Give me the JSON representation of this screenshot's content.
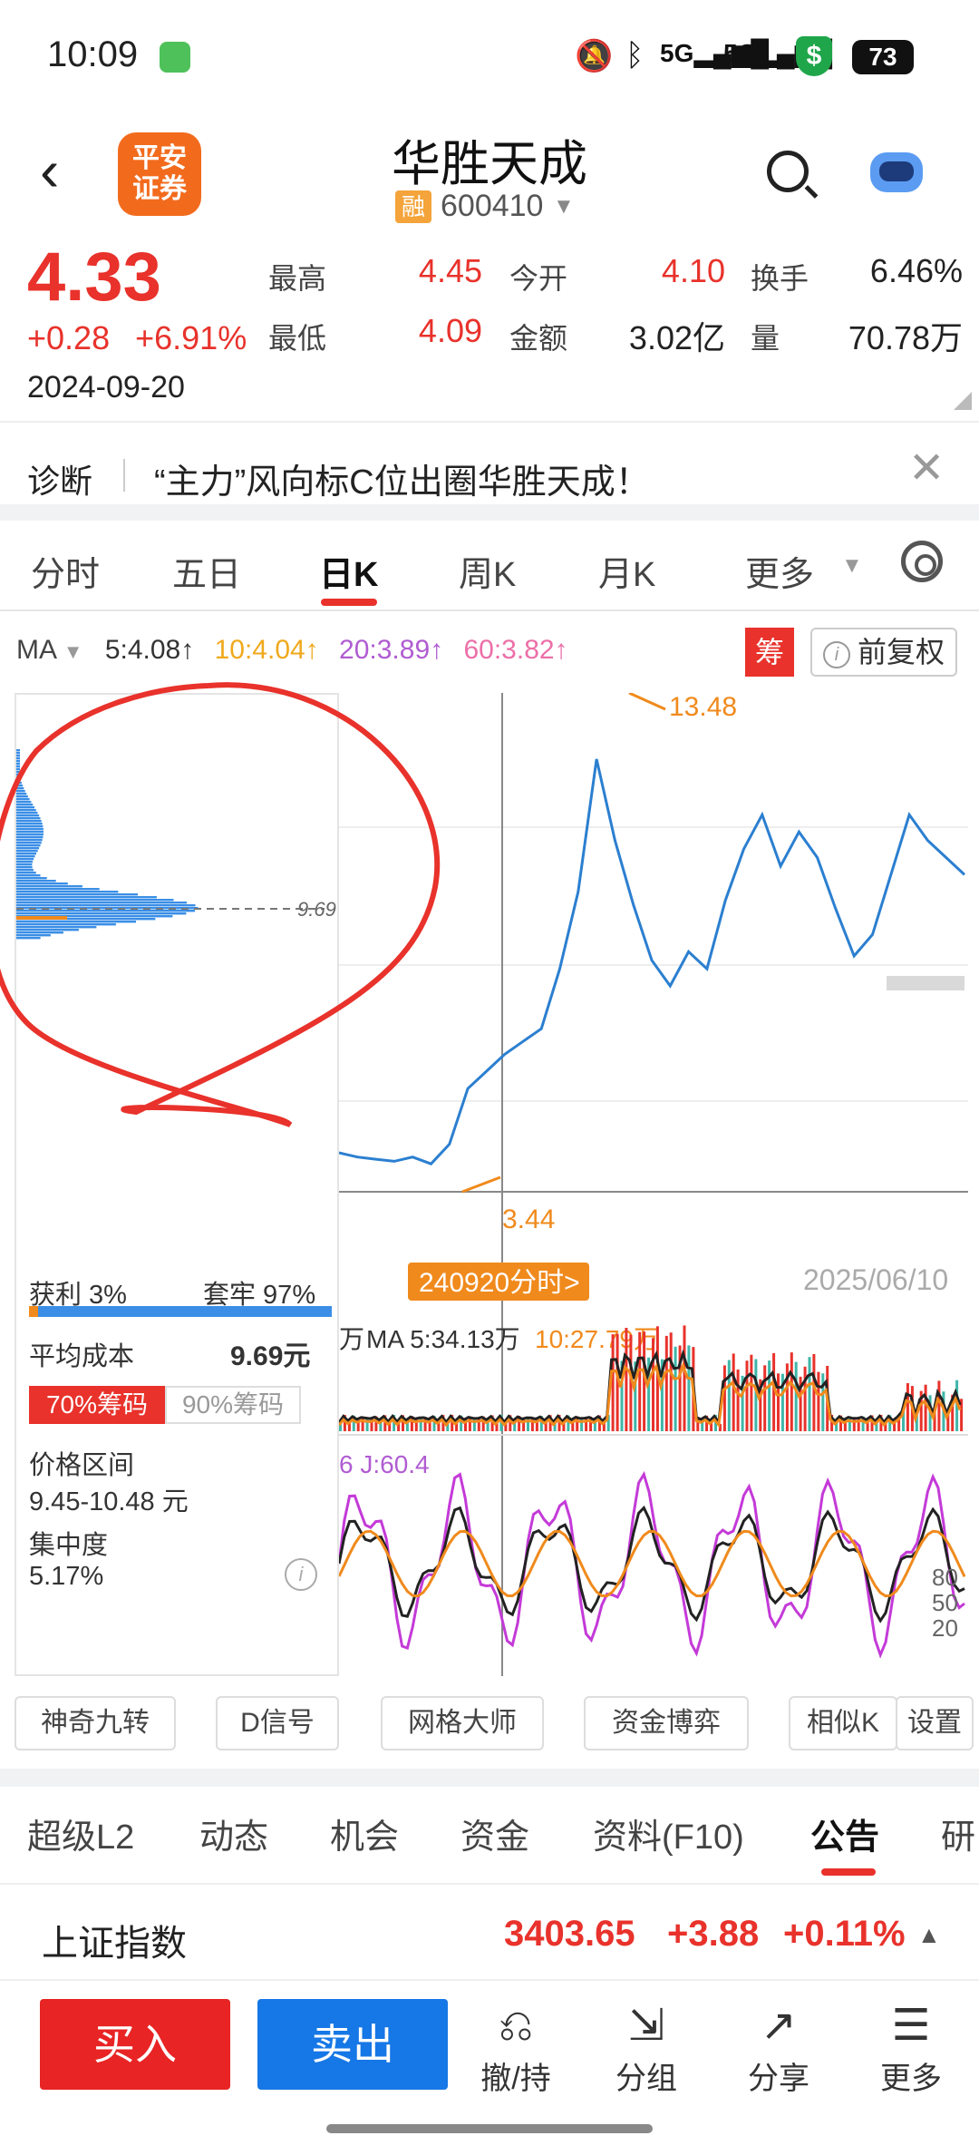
{
  "status": {
    "time": "10:09",
    "battery": "73"
  },
  "header": {
    "title": "华胜天成",
    "rong": "融",
    "code": "600410",
    "logo_text_1": "平安",
    "logo_text_2": "证券"
  },
  "quote": {
    "price": "4.33",
    "change": "+0.28",
    "change_pct": "+6.91%",
    "date": "2024-09-20",
    "high_label": "最高",
    "high": "4.45",
    "open_label": "今开",
    "open": "4.10",
    "turnover_label": "换手",
    "turnover": "6.46%",
    "low_label": "最低",
    "low": "4.09",
    "amount_label": "金额",
    "amount": "3.02亿",
    "volume_label": "量",
    "volume": "70.78万"
  },
  "diagnosis": {
    "label": "诊断",
    "text": "“主力”风向标C位出圈华胜天成！"
  },
  "tabs": [
    "分时",
    "五日",
    "日K",
    "周K",
    "月K",
    "更多"
  ],
  "ma": {
    "label": "MA",
    "ma5": "5:4.08↑",
    "ma10": "10:4.04↑",
    "ma20": "20:3.89↑",
    "ma60": "60:3.82↑",
    "chou": "筹",
    "fuquan": "前复权",
    "info": "i"
  },
  "chart": {
    "peak_label": "13.48",
    "low_label": "3.44",
    "cost_marker": "9.69",
    "cursor_tag": "240920分时>",
    "end_date": "2025/06/10",
    "vol_legend_prefix": "万",
    "vol_legend": "MA 5:34.13万",
    "vol_legend_10": "10:27.79万",
    "kdj_legend": "6 J:60.4",
    "kdj_ticks": [
      "80",
      "50",
      "20"
    ]
  },
  "chart_data": {
    "type": "line",
    "title": "",
    "series": [
      {
        "name": "",
        "values": [
          3.7,
          3.6,
          3.55,
          3.5,
          3.6,
          3.44,
          3.9,
          5.2,
          5.6,
          6.0,
          6.3,
          6.6,
          8.0,
          9.8,
          12.9,
          11.0,
          9.5,
          8.2,
          7.6,
          8.4,
          8.0,
          9.6,
          10.8,
          11.6,
          10.4,
          11.2,
          10.6,
          9.4,
          8.3,
          8.8,
          10.2,
          11.6,
          11.0,
          10.6,
          10.2
        ]
      }
    ],
    "annotations": [
      "13.48",
      "3.44"
    ]
  },
  "chip": {
    "profit_label": "获利 3%",
    "trapped_label": "套牢 97%",
    "avg_cost_label": "平均成本",
    "avg_cost": "9.69元",
    "chip70": "70%筹码",
    "chip90": "90%筹码",
    "price_range_label": "价格区间",
    "price_range": "9.45-10.48 元",
    "concentration_label": "集中度",
    "concentration": "5.17%",
    "info": "i",
    "distribution": {
      "profit_pct": 3,
      "trapped_pct": 97
    }
  },
  "tools": [
    "神奇九转",
    "D信号",
    "网格大师",
    "资金博弈",
    "相似K",
    "设置"
  ],
  "bottom_tabs": [
    "超级L2",
    "动态",
    "机会",
    "资金",
    "资料(F10)",
    "公告",
    "研"
  ],
  "index": {
    "name": "上证指数",
    "value": "3403.65",
    "change": "+3.88",
    "pct": "+0.11%"
  },
  "actions": {
    "buy": "买入",
    "sell": "卖出",
    "cancel": "撤/持",
    "group": "分组",
    "share": "分享",
    "more": "更多"
  },
  "colors": {
    "up": "#e8322b",
    "down": "#3a8ee6",
    "accent": "#f08a1c",
    "ma10": "#f0a91c",
    "ma20": "#b05cd1",
    "ma60": "#ec6fa8"
  }
}
